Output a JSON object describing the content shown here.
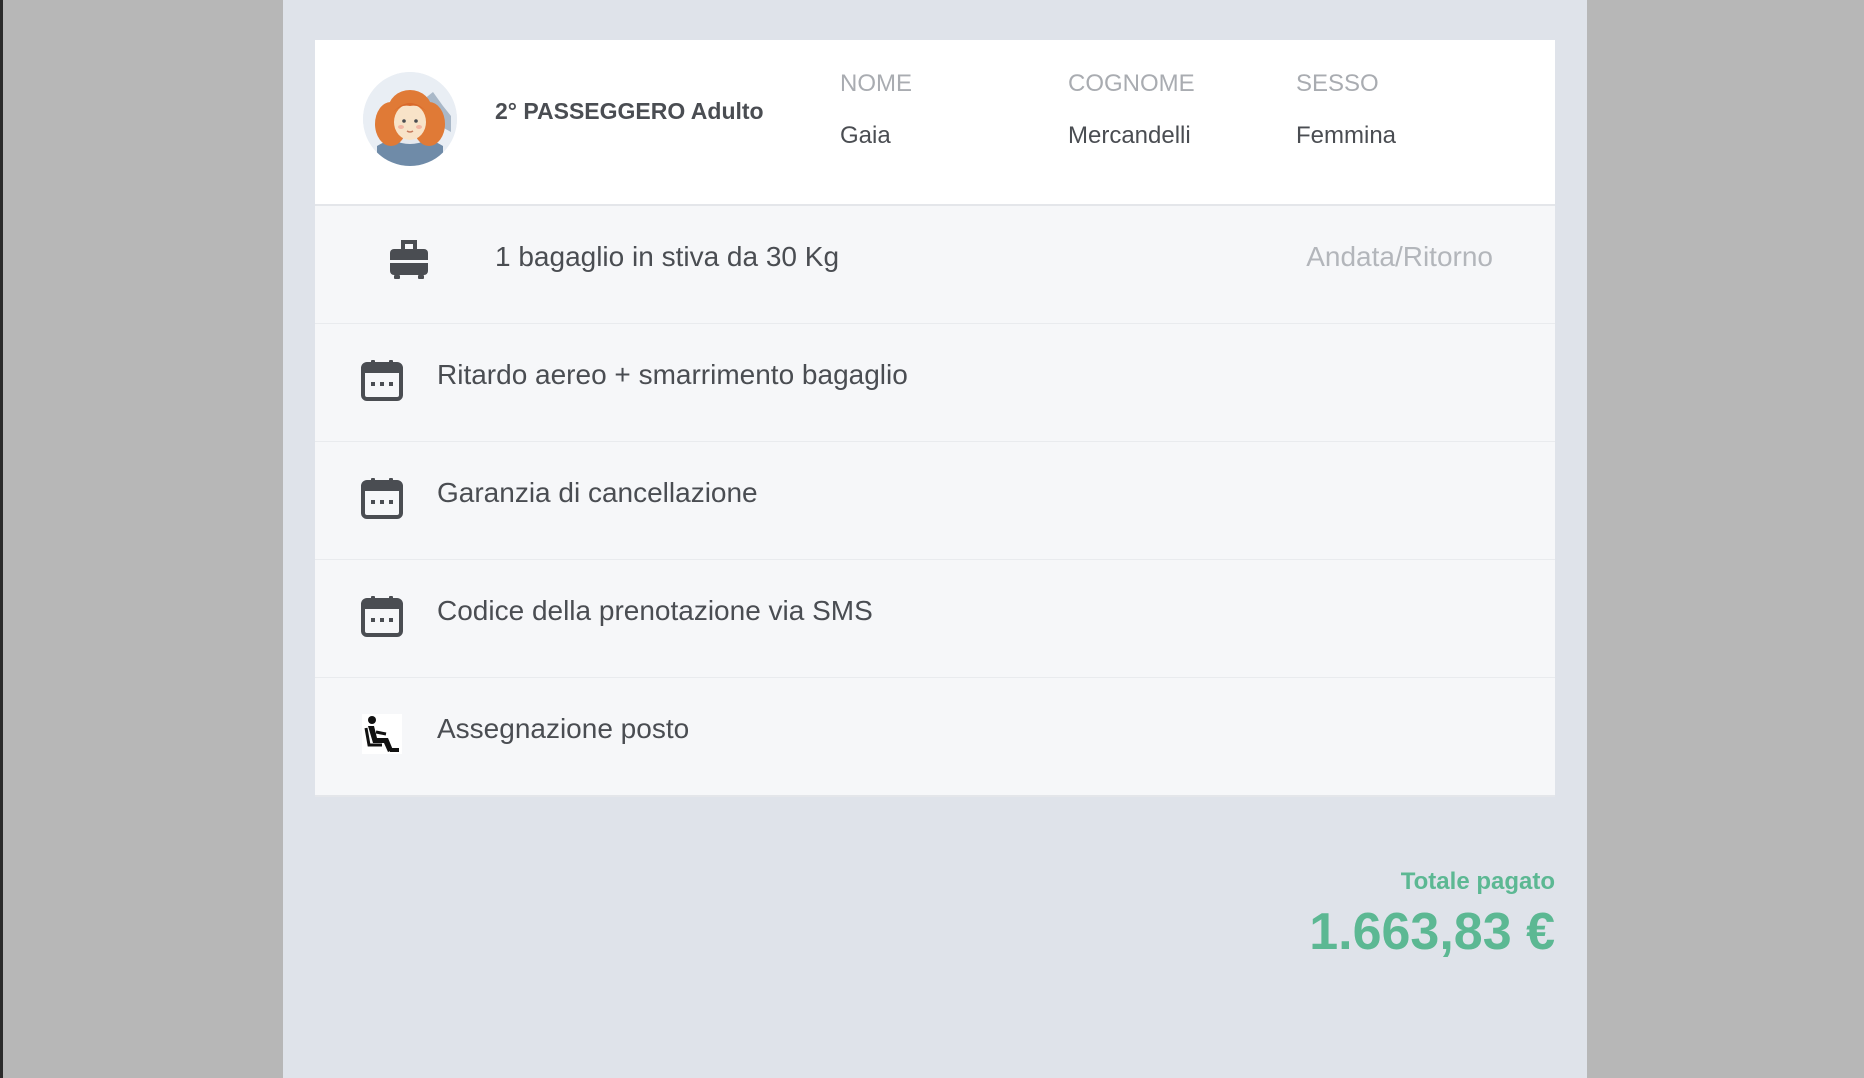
{
  "passenger": {
    "title": "2° PASSEGGERO Adulto",
    "avatar": "female-passenger-avatar",
    "fields": [
      {
        "label": "NOME",
        "value": "Gaia"
      },
      {
        "label": "COGNOME",
        "value": "Mercandelli"
      },
      {
        "label": "SESSO",
        "value": "Femmina"
      }
    ]
  },
  "services": [
    {
      "icon": "luggage-icon",
      "label": "1 bagaglio in stiva da 30 Kg",
      "detail": "Andata/Ritorno"
    },
    {
      "icon": "calendar-icon",
      "label": "Ritardo aereo + smarrimento bagaglio"
    },
    {
      "icon": "calendar-icon",
      "label": "Garanzia di cancellazione"
    },
    {
      "icon": "calendar-icon",
      "label": "Codice della prenotazione via SMS"
    },
    {
      "icon": "seat-icon",
      "label": "Assegnazione posto"
    }
  ],
  "total": {
    "label": "Totale pagato",
    "amount": "1.663,83 €"
  },
  "colors": {
    "accent_green": "#5cb893",
    "page_bg": "#dfe3ea",
    "outer_bg": "#b7b7b7"
  }
}
